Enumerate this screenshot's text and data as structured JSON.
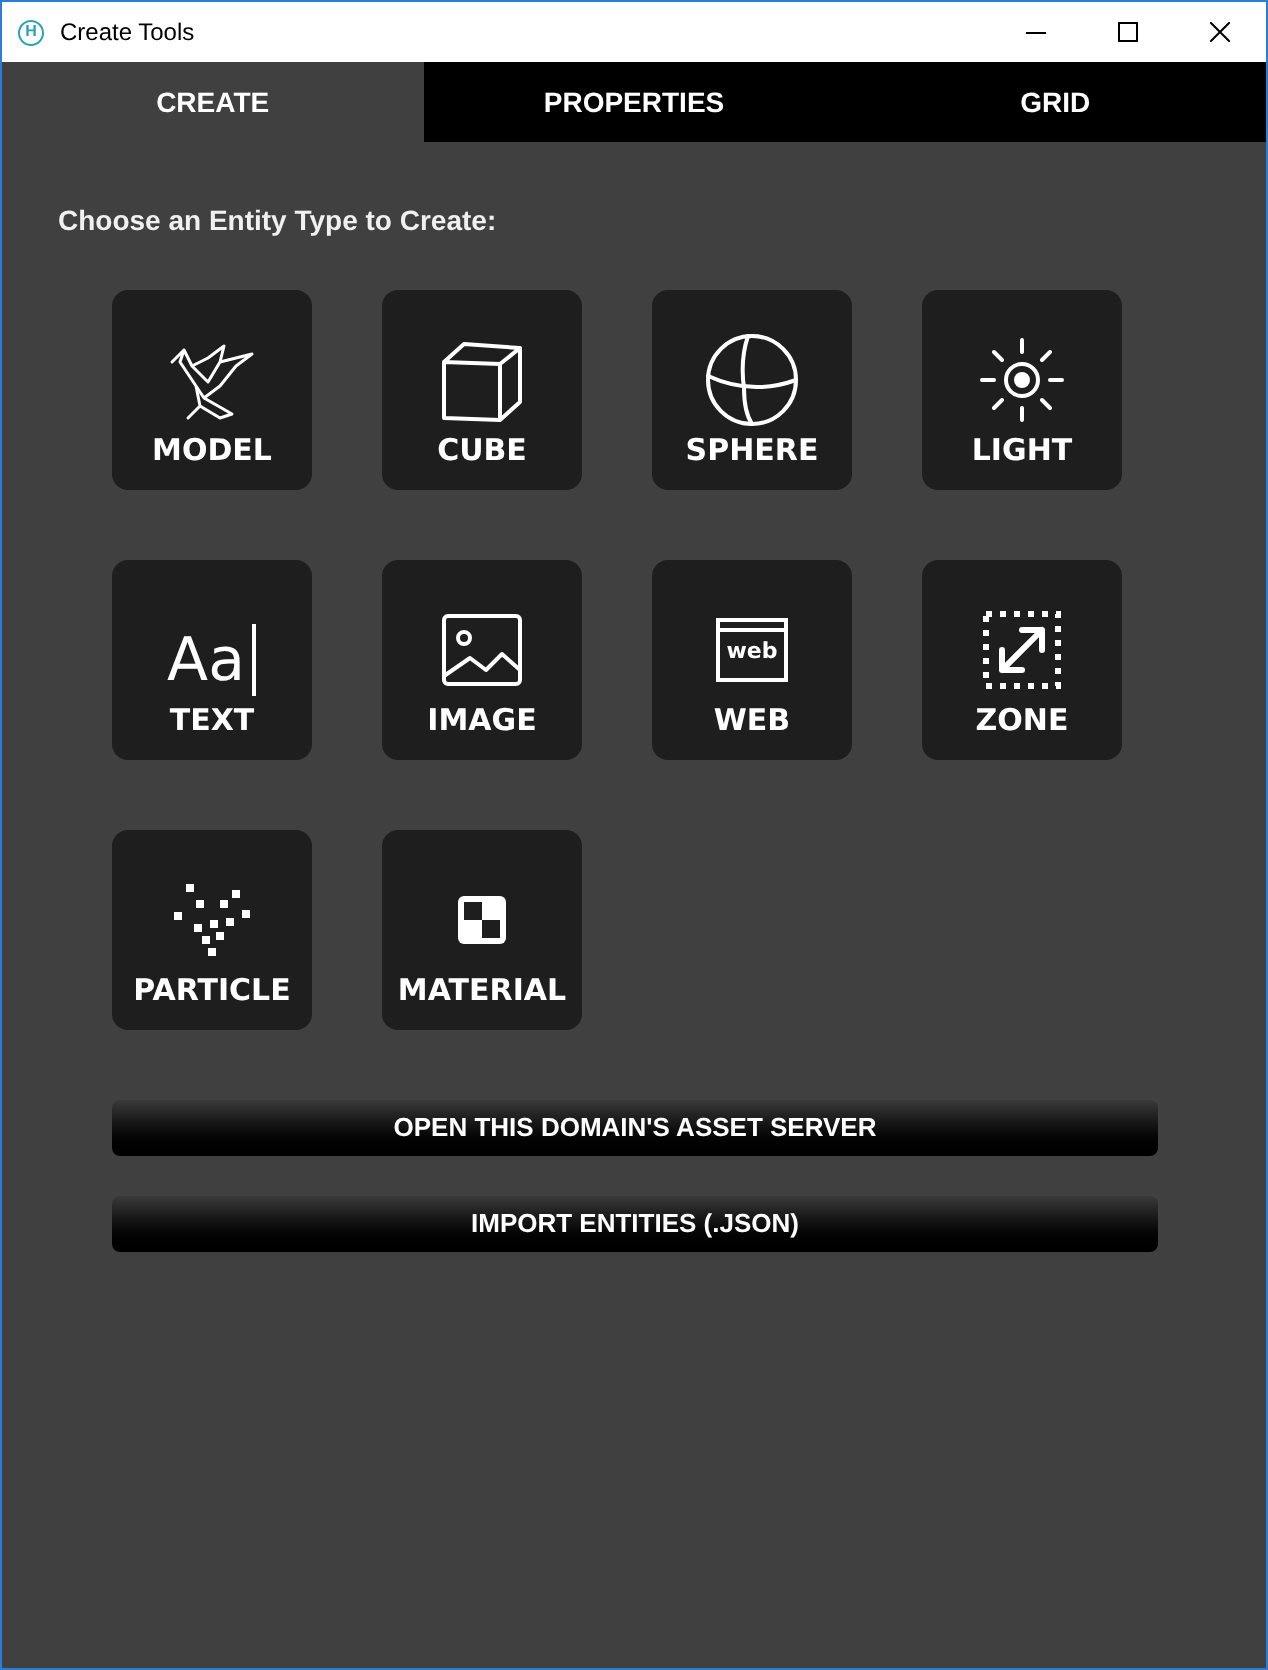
{
  "window": {
    "title": "Create Tools",
    "logo_text": "H"
  },
  "tabs": [
    {
      "label": "CREATE",
      "selected": true
    },
    {
      "label": "PROPERTIES",
      "selected": false
    },
    {
      "label": "GRID",
      "selected": false
    }
  ],
  "heading": "Choose an Entity Type to Create:",
  "entities": [
    {
      "label": "MODEL"
    },
    {
      "label": "CUBE"
    },
    {
      "label": "SPHERE"
    },
    {
      "label": "LIGHT"
    },
    {
      "label": "TEXT",
      "icon_text": "Aa"
    },
    {
      "label": "IMAGE"
    },
    {
      "label": "WEB",
      "icon_text": "web"
    },
    {
      "label": "ZONE"
    },
    {
      "label": "PARTICLE"
    },
    {
      "label": "MATERIAL"
    }
  ],
  "buttons": [
    "OPEN THIS DOMAIN'S ASSET SERVER",
    "IMPORT ENTITIES (.JSON)"
  ]
}
